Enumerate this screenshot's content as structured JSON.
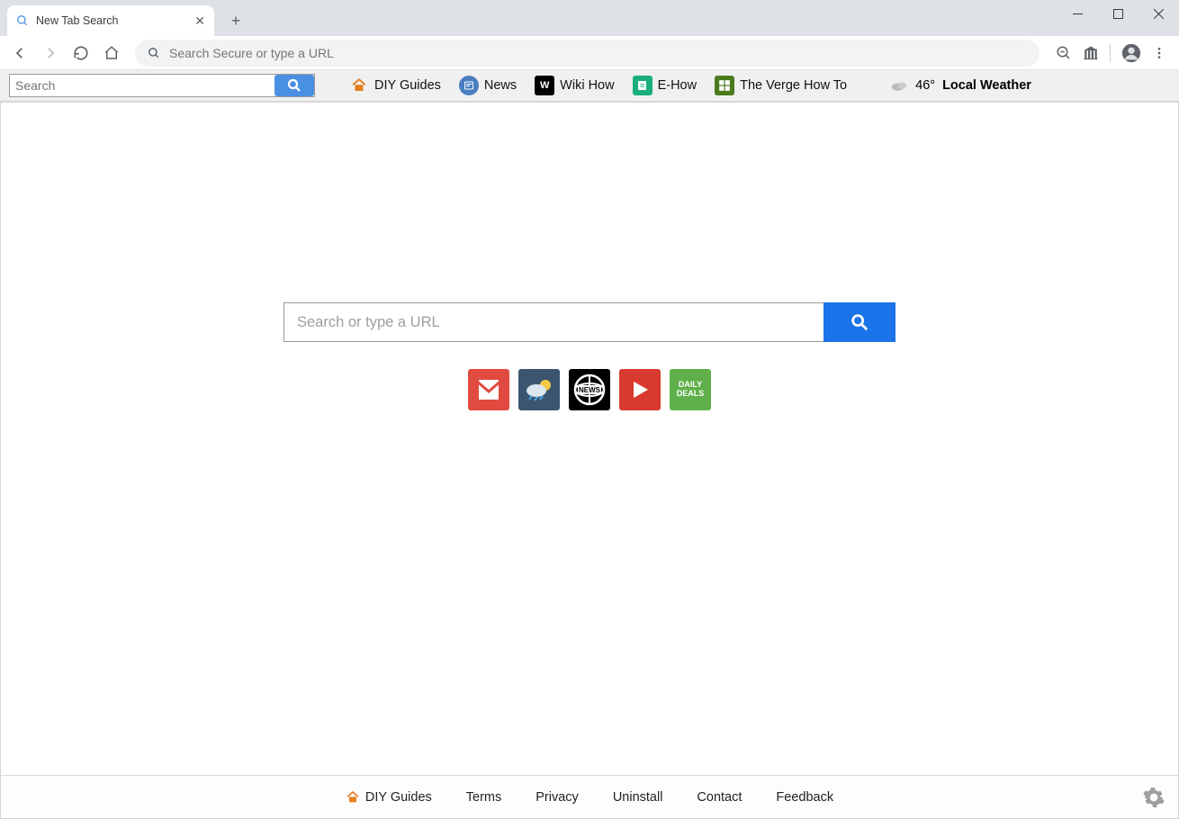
{
  "window": {
    "tab_title": "New Tab Search"
  },
  "toolbar": {
    "omnibox_placeholder": "Search Secure or type a URL"
  },
  "ext": {
    "search_placeholder": "Search",
    "links": [
      {
        "label": "DIY Guides"
      },
      {
        "label": "News"
      },
      {
        "label": "Wiki How"
      },
      {
        "label": "E-How"
      },
      {
        "label": "The Verge How To"
      }
    ],
    "weather": {
      "temp": "46°",
      "label": "Local Weather"
    }
  },
  "main": {
    "search_placeholder": "Search or type a URL",
    "tiles": [
      {
        "name": "Gmail"
      },
      {
        "name": "Weather"
      },
      {
        "name": "News"
      },
      {
        "name": "Video"
      },
      {
        "name": "Daily Deals",
        "text": "DAILY DEALS"
      }
    ]
  },
  "footer": {
    "links": [
      {
        "label": "DIY Guides"
      },
      {
        "label": "Terms"
      },
      {
        "label": "Privacy"
      },
      {
        "label": "Uninstall"
      },
      {
        "label": "Contact"
      },
      {
        "label": "Feedback"
      }
    ]
  }
}
